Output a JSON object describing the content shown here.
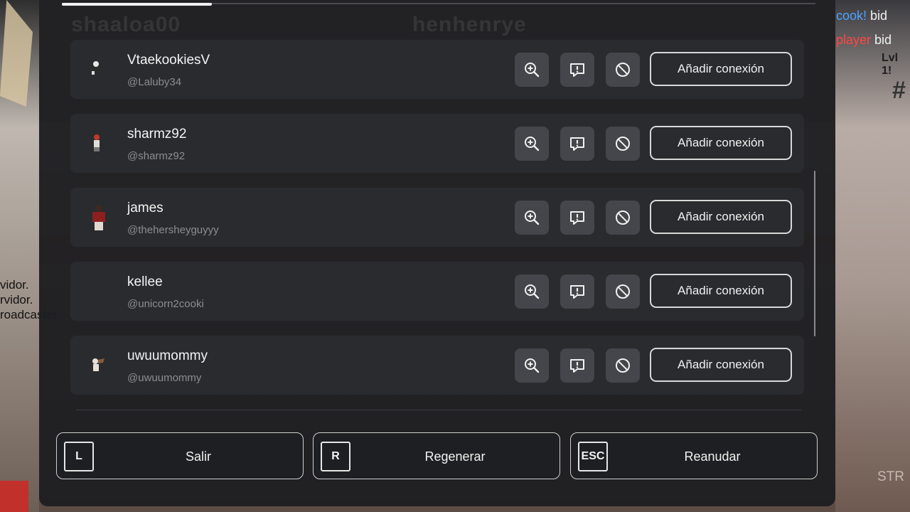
{
  "background": {
    "chat": [
      {
        "name": "cook!",
        "text": "bid"
      },
      {
        "name": "player",
        "text": "bid"
      }
    ],
    "level_text": "Lvl 1!",
    "hash_text": "#",
    "strike_text": "STR",
    "left_chat": [
      "vidor.",
      "rvidor.",
      "roadcaster"
    ]
  },
  "modal": {
    "ghost_names": [
      "shaaloa00",
      "henhenrye"
    ],
    "users": [
      {
        "display_name": "VtaekookiesV",
        "handle": "@Laluby34",
        "add_label": "Añadir conexión"
      },
      {
        "display_name": "sharmz92",
        "handle": "@sharmz92",
        "add_label": "Añadir conexión"
      },
      {
        "display_name": "james",
        "handle": "@thehersheyguyyy",
        "add_label": "Añadir conexión"
      },
      {
        "display_name": "kellee",
        "handle": "@unicorn2cooki",
        "add_label": "Añadir conexión"
      },
      {
        "display_name": "uwuumommy",
        "handle": "@uwuumommy",
        "add_label": "Añadir conexión"
      }
    ],
    "icons": {
      "view": "zoom-in-icon",
      "report": "report-flag-icon",
      "block": "block-icon"
    }
  },
  "footer": {
    "leave": {
      "key": "L",
      "label": "Salir"
    },
    "reset": {
      "key": "R",
      "label": "Regenerar"
    },
    "resume": {
      "key": "ESC",
      "label": "Reanudar"
    }
  },
  "colors": {
    "panel": "#1c1d20",
    "row": "#2a2b2f",
    "icon_button": "#45464b",
    "text": "#f4f4f4",
    "muted": "#8c8d91"
  }
}
